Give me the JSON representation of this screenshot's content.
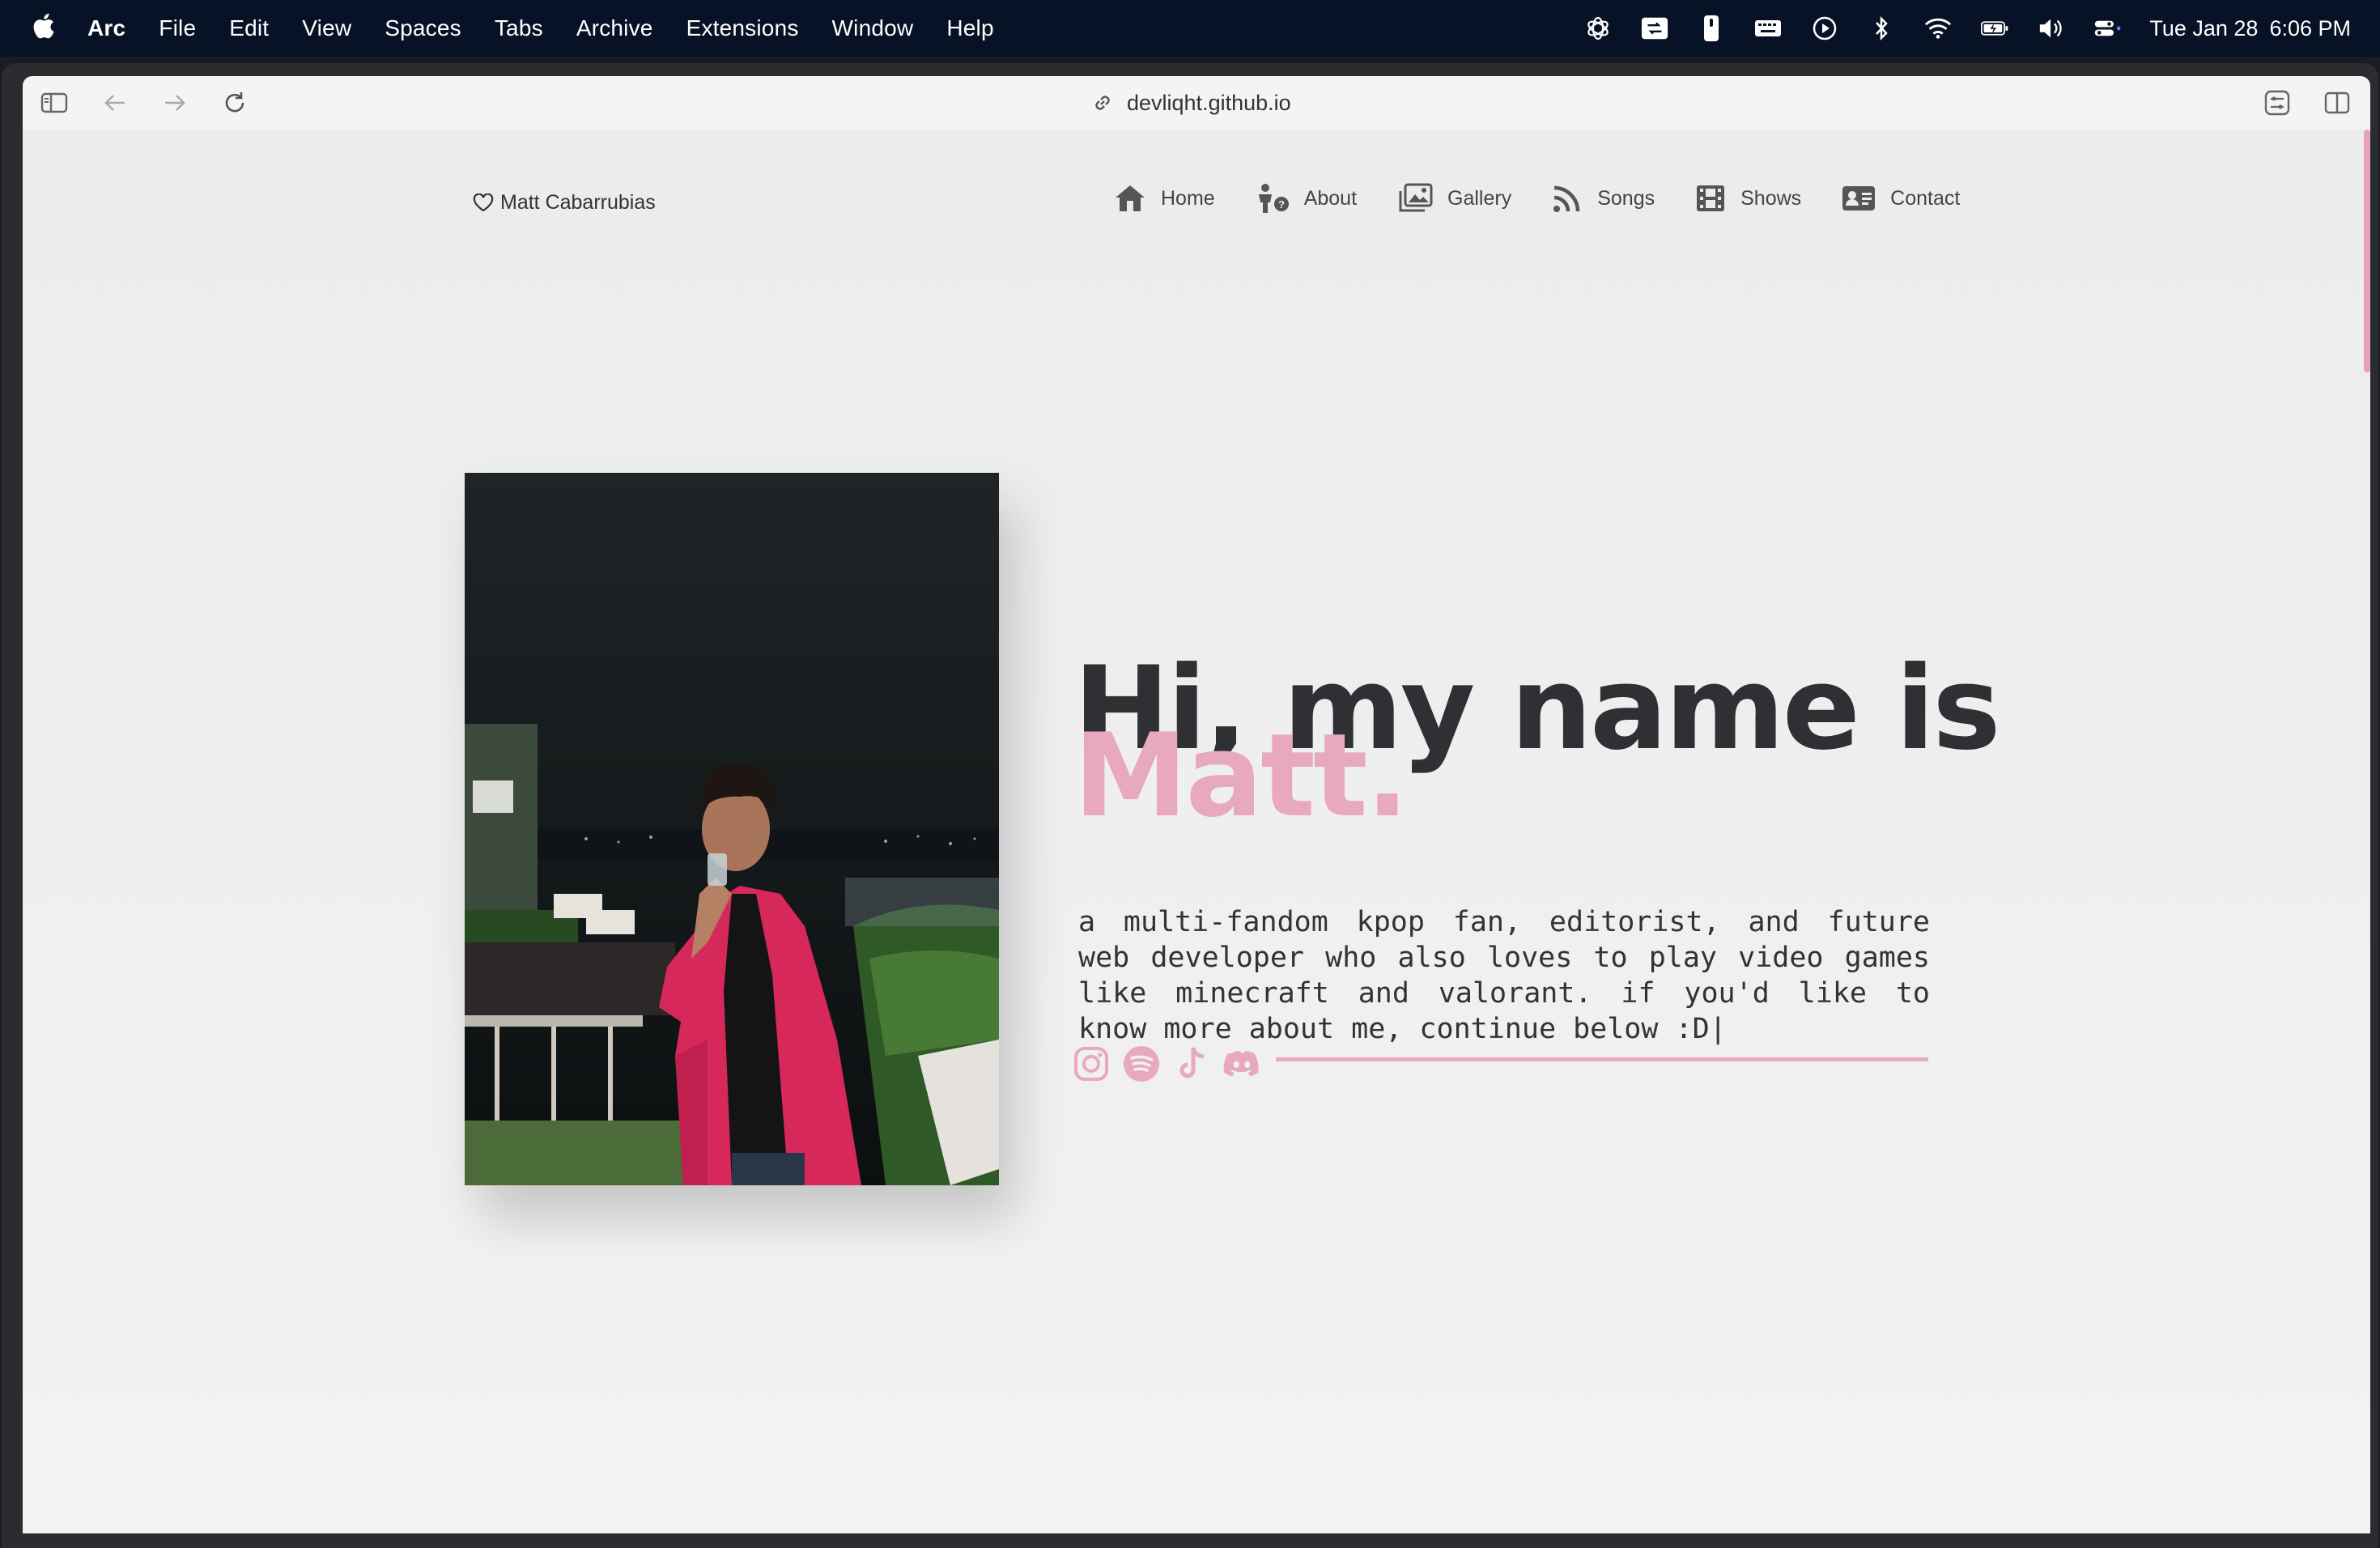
{
  "menubar": {
    "app": "Arc",
    "menus": [
      "File",
      "Edit",
      "View",
      "Spaces",
      "Tabs",
      "Archive",
      "Extensions",
      "Window",
      "Help"
    ],
    "date": "Tue Jan 28",
    "time": "6:06 PM"
  },
  "browser": {
    "url": "devliqht.github.io"
  },
  "site": {
    "brand": "Matt Cabarrubias",
    "nav": [
      {
        "label": "Home",
        "icon": "home-icon"
      },
      {
        "label": "About",
        "icon": "person-question-icon"
      },
      {
        "label": "Gallery",
        "icon": "images-icon"
      },
      {
        "label": "Songs",
        "icon": "rss-icon"
      },
      {
        "label": "Shows",
        "icon": "film-icon"
      },
      {
        "label": "Contact",
        "icon": "contact-card-icon"
      }
    ],
    "hero": {
      "greeting": "Hi, my name is",
      "name": "Matt.",
      "bio": "a multi-fandom kpop fan, editorist, and future web developer who also loves to play video games like minecraft and valorant. if you'd like to know more about me, continue below :D|"
    },
    "socials": [
      "instagram-icon",
      "spotify-icon",
      "tiktok-icon",
      "discord-icon"
    ],
    "accent": "#e8a8c0"
  }
}
